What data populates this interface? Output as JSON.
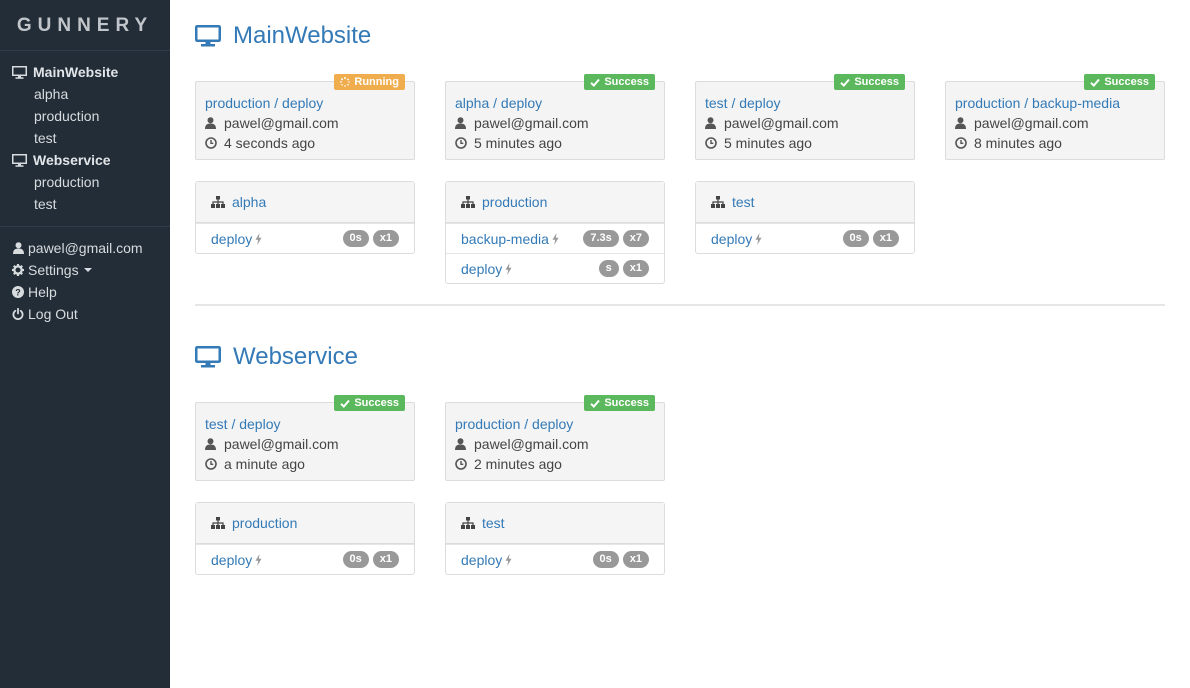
{
  "brand": "GUNNERY",
  "sidebar": {
    "projects": [
      {
        "name": "MainWebsite",
        "envs": [
          "alpha",
          "production",
          "test"
        ]
      },
      {
        "name": "Webservice",
        "envs": [
          "production",
          "test"
        ]
      }
    ],
    "user": "pawel@gmail.com",
    "settings": "Settings",
    "help": "Help",
    "logout": "Log Out"
  },
  "sections": [
    {
      "title": "MainWebsite",
      "cards": [
        {
          "title": "production / deploy",
          "status": "Running",
          "user": "pawel@gmail.com",
          "time": "4 seconds ago"
        },
        {
          "title": "alpha / deploy",
          "status": "Success",
          "user": "pawel@gmail.com",
          "time": "5 minutes ago"
        },
        {
          "title": "test / deploy",
          "status": "Success",
          "user": "pawel@gmail.com",
          "time": "5 minutes ago"
        },
        {
          "title": "production / backup-media",
          "status": "Success",
          "user": "pawel@gmail.com",
          "time": "8 minutes ago"
        }
      ],
      "environments": [
        {
          "name": "alpha",
          "tasks": [
            {
              "name": "deploy",
              "duration": "0s",
              "count": "x1"
            }
          ]
        },
        {
          "name": "production",
          "tasks": [
            {
              "name": "backup-media",
              "duration": "7.3s",
              "count": "x7"
            },
            {
              "name": "deploy",
              "duration": "s",
              "count": "x1"
            }
          ]
        },
        {
          "name": "test",
          "tasks": [
            {
              "name": "deploy",
              "duration": "0s",
              "count": "x1"
            }
          ]
        }
      ]
    },
    {
      "title": "Webservice",
      "cards": [
        {
          "title": "test / deploy",
          "status": "Success",
          "user": "pawel@gmail.com",
          "time": "a minute ago"
        },
        {
          "title": "production / deploy",
          "status": "Success",
          "user": "pawel@gmail.com",
          "time": "2 minutes ago"
        }
      ],
      "environments": [
        {
          "name": "production",
          "tasks": [
            {
              "name": "deploy",
              "duration": "0s",
              "count": "x1"
            }
          ]
        },
        {
          "name": "test",
          "tasks": [
            {
              "name": "deploy",
              "duration": "0s",
              "count": "x1"
            }
          ]
        }
      ]
    }
  ],
  "colors": {
    "sidebar": "#222d37",
    "link": "#337ab7",
    "success": "#5cb85c",
    "running": "#f0ad4e",
    "pill": "#999999"
  },
  "icons": {
    "project": "desktop-icon",
    "user": "user-icon",
    "time": "clock-icon",
    "env": "sitemap-icon",
    "task": "bolt-icon",
    "settings": "gear-icon",
    "help": "question-circle-icon",
    "logout": "power-icon"
  }
}
